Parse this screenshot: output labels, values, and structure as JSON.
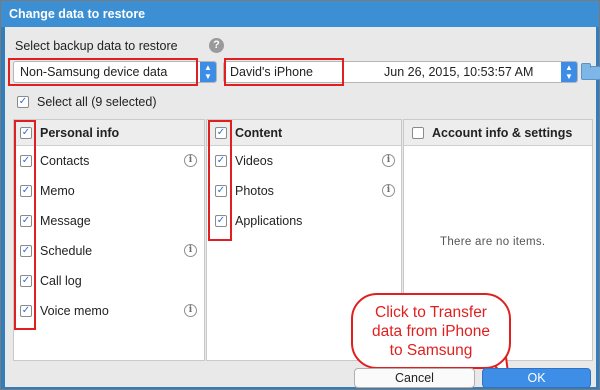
{
  "window": {
    "title": "Change data to restore"
  },
  "backup": {
    "label": "Select backup data to restore",
    "source_select": "Non-Samsung device data",
    "device_select": "David's iPhone",
    "date_select": "Jun 26, 2015, 10:53:57 AM"
  },
  "select_all": {
    "label": "Select all (9 selected)",
    "checked": true
  },
  "panels": {
    "personal": {
      "title": "Personal info",
      "items": [
        {
          "label": "Contacts",
          "info": true
        },
        {
          "label": "Memo",
          "info": false
        },
        {
          "label": "Message",
          "info": false
        },
        {
          "label": "Schedule",
          "info": true
        },
        {
          "label": "Call log",
          "info": false
        },
        {
          "label": "Voice memo",
          "info": true
        }
      ]
    },
    "content": {
      "title": "Content",
      "items": [
        {
          "label": "Videos",
          "info": true
        },
        {
          "label": "Photos",
          "info": true
        },
        {
          "label": "Applications",
          "info": false
        }
      ]
    },
    "account": {
      "title": "Account info & settings",
      "empty_text": "There are no items."
    }
  },
  "callout": {
    "line1": "Click to Transfer",
    "line2": "data from iPhone",
    "line3": "to Samsung"
  },
  "buttons": {
    "cancel": "Cancel",
    "ok": "OK"
  },
  "icons": {
    "help": "question-circle-icon",
    "info": "info-circle-icon",
    "folder": "folder-icon",
    "select_arrow": "up-down-chevron-icon"
  },
  "colors": {
    "accent": "#3e8ee8",
    "title_bar": "#3b8fd2",
    "annotation": "#e02020"
  }
}
